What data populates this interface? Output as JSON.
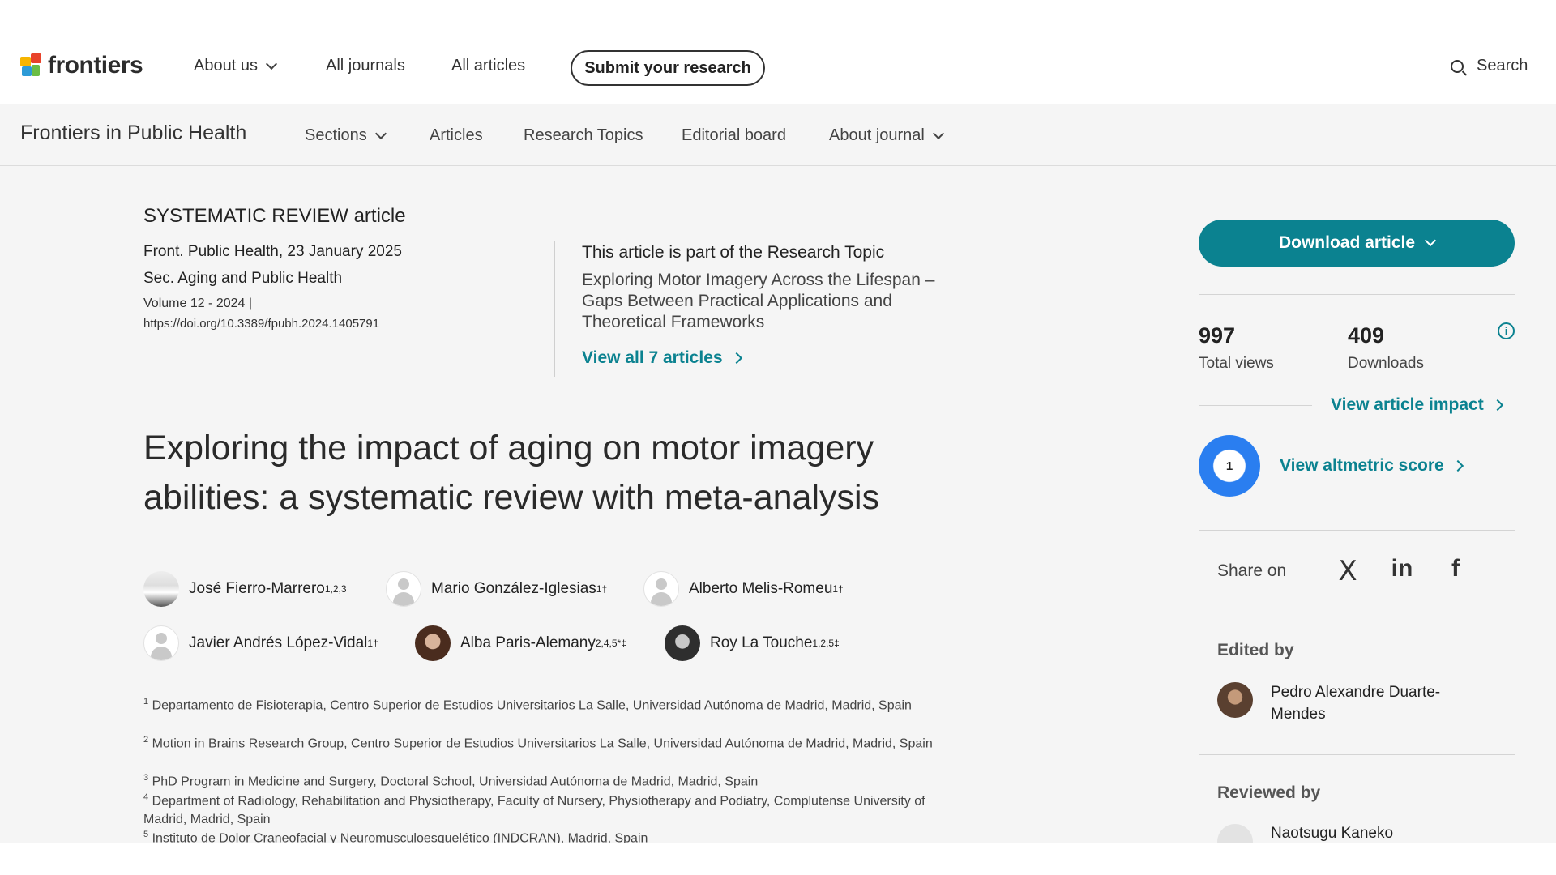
{
  "header": {
    "logo_text": "frontiers",
    "nav": [
      "About us",
      "All journals",
      "All articles"
    ],
    "submit_label": "Submit your research",
    "search_label": "Search"
  },
  "journal_nav": {
    "title": "Frontiers in Public Health",
    "items": [
      "Sections",
      "Articles",
      "Research Topics",
      "Editorial board",
      "About journal"
    ]
  },
  "article": {
    "type": "SYSTEMATIC REVIEW article",
    "citation": "Front. Public Health, 23 January 2025",
    "section": "Sec. Aging and Public Health",
    "volume": "Volume 12 - 2024 |",
    "doi": "https://doi.org/10.3389/fpubh.2024.1405791",
    "title": "Exploring the impact of aging on motor imagery abilities: a systematic review with meta-analysis"
  },
  "research_topic": {
    "intro": "This article is part of the Research Topic",
    "title": "Exploring Motor Imagery Across the Lifespan – Gaps Between Practical Applications and Theoretical Frameworks",
    "view_all": "View all 7 articles"
  },
  "authors": [
    {
      "name": "José Fierro-Marrero",
      "sup": "1,2,3"
    },
    {
      "name": "Mario González-Iglesias",
      "sup": "1†"
    },
    {
      "name": "Alberto Melis-Romeu",
      "sup": "1†"
    },
    {
      "name": "Javier Andrés López-Vidal",
      "sup": "1†"
    },
    {
      "name": "Alba Paris-Alemany",
      "sup": "2,4,5*‡"
    },
    {
      "name": "Roy La Touche",
      "sup": "1,2,5‡"
    }
  ],
  "affiliations": [
    {
      "num": "1",
      "text": "Departamento de Fisioterapia, Centro Superior de Estudios Universitarios La Salle, Universidad Autónoma de Madrid, Madrid, Spain"
    },
    {
      "num": "2",
      "text": "Motion in Brains Research Group, Centro Superior de Estudios Universitarios La Salle, Universidad Autónoma de Madrid, Madrid, Spain"
    },
    {
      "num": "3",
      "text": "PhD Program in Medicine and Surgery, Doctoral School, Universidad Autónoma de Madrid, Madrid, Spain"
    },
    {
      "num": "4",
      "text": "Department of Radiology, Rehabilitation and Physiotherapy, Faculty of Nursery, Physiotherapy and Podiatry, Complutense University of Madrid, Madrid, Spain"
    },
    {
      "num": "5",
      "text": "Instituto de Dolor Craneofacial y Neuromusculoesquelético (INDCRAN), Madrid, Spain"
    }
  ],
  "sidebar": {
    "download_label": "Download article",
    "views_num": "997",
    "views_label": "Total views",
    "downloads_num": "409",
    "downloads_label": "Downloads",
    "impact_link": "View article impact",
    "altmetric_score": "1",
    "altmetric_link": "View altmetric score",
    "share_label": "Share on",
    "social": [
      "X",
      "in",
      "f"
    ],
    "edited_by_label": "Edited by",
    "editor_name": "Pedro Alexandre Duarte-Mendes",
    "reviewed_by_label": "Reviewed by",
    "reviewer_name": "Naotsugu Kaneko"
  },
  "colors": {
    "accent": "#0b8290",
    "altmetric": "#2a7ef0"
  }
}
